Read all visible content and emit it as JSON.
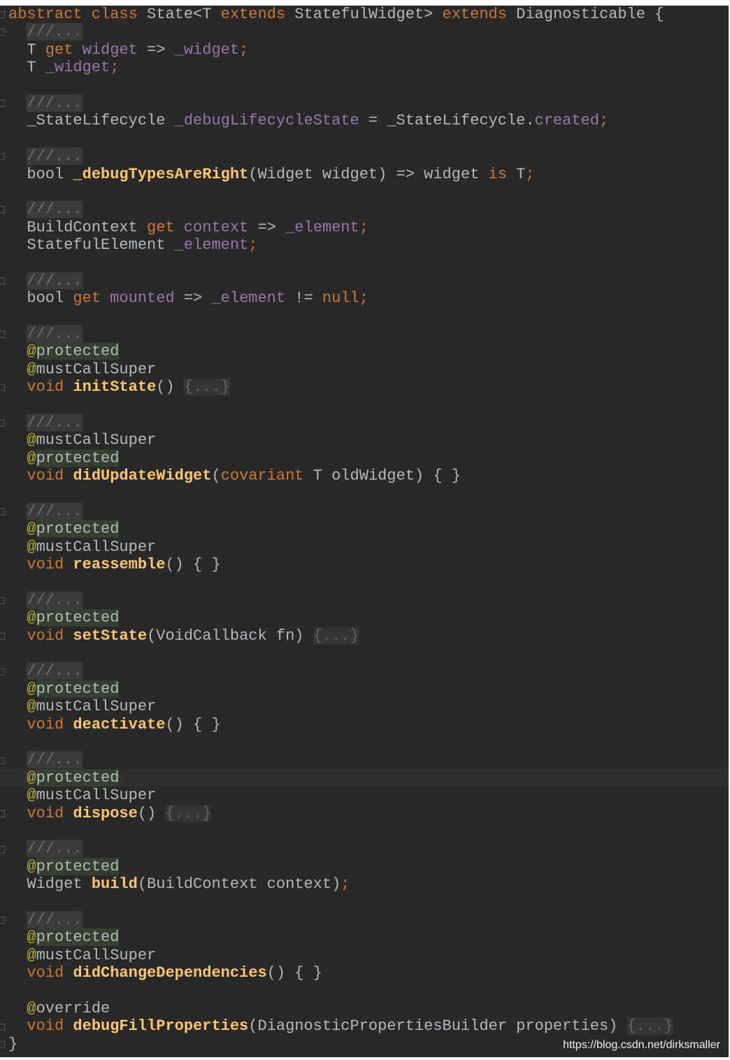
{
  "watermark": "https://blog.csdn.net/dirksmaller",
  "highlighted_line": 43,
  "colors": {
    "background": "#282828",
    "keyword": "#cc7832",
    "field": "#9876aa",
    "method": "#ffc66d",
    "annotation": "#bbb529",
    "plain": "#b4b8bc"
  },
  "lines": [
    [
      [
        "k",
        "abstract class "
      ],
      [
        "p",
        "State<T "
      ],
      [
        "k",
        "extends "
      ],
      [
        "p",
        "StatefulWidget> "
      ],
      [
        "k",
        "extends "
      ],
      [
        "p",
        "Diagnosticable {"
      ]
    ],
    [
      [
        "p",
        "  "
      ],
      [
        "c",
        "///..."
      ]
    ],
    [
      [
        "p",
        "  T "
      ],
      [
        "k",
        "get "
      ],
      [
        "f",
        "widget"
      ],
      [
        "p",
        " => "
      ],
      [
        "f",
        "_widget"
      ],
      [
        "s",
        ";"
      ]
    ],
    [
      [
        "p",
        "  T "
      ],
      [
        "f",
        "_widget"
      ],
      [
        "s",
        ";"
      ]
    ],
    [],
    [
      [
        "p",
        "  "
      ],
      [
        "c",
        "///..."
      ]
    ],
    [
      [
        "p",
        "  _StateLifecycle "
      ],
      [
        "f",
        "_debugLifecycleState"
      ],
      [
        "p",
        " = _StateLifecycle."
      ],
      [
        "f",
        "created"
      ],
      [
        "s",
        ";"
      ]
    ],
    [],
    [
      [
        "p",
        "  "
      ],
      [
        "c",
        "///..."
      ]
    ],
    [
      [
        "p",
        "  bool "
      ],
      [
        "m",
        "_debugTypesAreRight"
      ],
      [
        "p",
        "(Widget widget) => widget "
      ],
      [
        "k",
        "is "
      ],
      [
        "p",
        "T"
      ],
      [
        "s",
        ";"
      ]
    ],
    [],
    [
      [
        "p",
        "  "
      ],
      [
        "c",
        "///..."
      ]
    ],
    [
      [
        "p",
        "  BuildContext "
      ],
      [
        "k",
        "get "
      ],
      [
        "f",
        "context"
      ],
      [
        "p",
        " => "
      ],
      [
        "f",
        "_element"
      ],
      [
        "s",
        ";"
      ]
    ],
    [
      [
        "p",
        "  StatefulElement "
      ],
      [
        "f",
        "_element"
      ],
      [
        "s",
        ";"
      ]
    ],
    [],
    [
      [
        "p",
        "  "
      ],
      [
        "c",
        "///..."
      ]
    ],
    [
      [
        "p",
        "  bool "
      ],
      [
        "k",
        "get "
      ],
      [
        "f",
        "mounted"
      ],
      [
        "p",
        " => "
      ],
      [
        "f",
        "_element"
      ],
      [
        "p",
        " != "
      ],
      [
        "k",
        "null"
      ],
      [
        "s",
        ";"
      ]
    ],
    [],
    [
      [
        "p",
        "  "
      ],
      [
        "c",
        "///..."
      ]
    ],
    [
      [
        "p",
        "  "
      ],
      [
        "a",
        "@"
      ],
      [
        "anp",
        "protected"
      ]
    ],
    [
      [
        "p",
        "  "
      ],
      [
        "a",
        "@"
      ],
      [
        "an",
        "mustCallSuper"
      ]
    ],
    [
      [
        "p",
        "  "
      ],
      [
        "k",
        "void "
      ],
      [
        "m",
        "initState"
      ],
      [
        "p",
        "() "
      ],
      [
        "fold",
        "{...}"
      ]
    ],
    [],
    [
      [
        "p",
        "  "
      ],
      [
        "c",
        "///..."
      ]
    ],
    [
      [
        "p",
        "  "
      ],
      [
        "a",
        "@"
      ],
      [
        "an",
        "mustCallSuper"
      ]
    ],
    [
      [
        "p",
        "  "
      ],
      [
        "a",
        "@"
      ],
      [
        "anp",
        "protected"
      ]
    ],
    [
      [
        "p",
        "  "
      ],
      [
        "k",
        "void "
      ],
      [
        "m",
        "didUpdateWidget"
      ],
      [
        "p",
        "("
      ],
      [
        "k",
        "covariant "
      ],
      [
        "p",
        "T oldWidget) { }"
      ]
    ],
    [],
    [
      [
        "p",
        "  "
      ],
      [
        "c",
        "///..."
      ]
    ],
    [
      [
        "p",
        "  "
      ],
      [
        "a",
        "@"
      ],
      [
        "anp",
        "protected"
      ]
    ],
    [
      [
        "p",
        "  "
      ],
      [
        "a",
        "@"
      ],
      [
        "an",
        "mustCallSuper"
      ]
    ],
    [
      [
        "p",
        "  "
      ],
      [
        "k",
        "void "
      ],
      [
        "m",
        "reassemble"
      ],
      [
        "p",
        "() { }"
      ]
    ],
    [],
    [
      [
        "p",
        "  "
      ],
      [
        "c",
        "///..."
      ]
    ],
    [
      [
        "p",
        "  "
      ],
      [
        "a",
        "@"
      ],
      [
        "anp",
        "protected"
      ]
    ],
    [
      [
        "p",
        "  "
      ],
      [
        "k",
        "void "
      ],
      [
        "m",
        "setState"
      ],
      [
        "p",
        "(VoidCallback fn) "
      ],
      [
        "fold",
        "{...}"
      ]
    ],
    [],
    [
      [
        "p",
        "  "
      ],
      [
        "c",
        "///..."
      ]
    ],
    [
      [
        "p",
        "  "
      ],
      [
        "a",
        "@"
      ],
      [
        "anp",
        "protected"
      ]
    ],
    [
      [
        "p",
        "  "
      ],
      [
        "a",
        "@"
      ],
      [
        "an",
        "mustCallSuper"
      ]
    ],
    [
      [
        "p",
        "  "
      ],
      [
        "k",
        "void "
      ],
      [
        "m",
        "deactivate"
      ],
      [
        "p",
        "() { }"
      ]
    ],
    [],
    [
      [
        "p",
        "  "
      ],
      [
        "c",
        "///..."
      ]
    ],
    [
      [
        "p",
        "  "
      ],
      [
        "a",
        "@"
      ],
      [
        "anp",
        "protected"
      ]
    ],
    [
      [
        "p",
        "  "
      ],
      [
        "a",
        "@"
      ],
      [
        "an",
        "mustCallSuper"
      ]
    ],
    [
      [
        "p",
        "  "
      ],
      [
        "k",
        "void "
      ],
      [
        "m",
        "dispose"
      ],
      [
        "p",
        "() "
      ],
      [
        "fold",
        "{...}"
      ]
    ],
    [],
    [
      [
        "p",
        "  "
      ],
      [
        "c",
        "///..."
      ]
    ],
    [
      [
        "p",
        "  "
      ],
      [
        "a",
        "@"
      ],
      [
        "anp",
        "protected"
      ]
    ],
    [
      [
        "p",
        "  Widget "
      ],
      [
        "m",
        "build"
      ],
      [
        "p",
        "(BuildContext context)"
      ],
      [
        "s",
        ";"
      ]
    ],
    [],
    [
      [
        "p",
        "  "
      ],
      [
        "c",
        "///..."
      ]
    ],
    [
      [
        "p",
        "  "
      ],
      [
        "a",
        "@"
      ],
      [
        "anp",
        "protected"
      ]
    ],
    [
      [
        "p",
        "  "
      ],
      [
        "a",
        "@"
      ],
      [
        "an",
        "mustCallSuper"
      ]
    ],
    [
      [
        "p",
        "  "
      ],
      [
        "k",
        "void "
      ],
      [
        "m",
        "didChangeDependencies"
      ],
      [
        "p",
        "() { }"
      ]
    ],
    [],
    [
      [
        "p",
        "  "
      ],
      [
        "a",
        "@"
      ],
      [
        "an",
        "override"
      ]
    ],
    [
      [
        "p",
        "  "
      ],
      [
        "k",
        "void "
      ],
      [
        "m",
        "debugFillProperties"
      ],
      [
        "p",
        "(DiagnosticPropertiesBuilder properties) "
      ],
      [
        "fold",
        "{...}"
      ]
    ],
    [
      [
        "p",
        "}"
      ]
    ]
  ]
}
